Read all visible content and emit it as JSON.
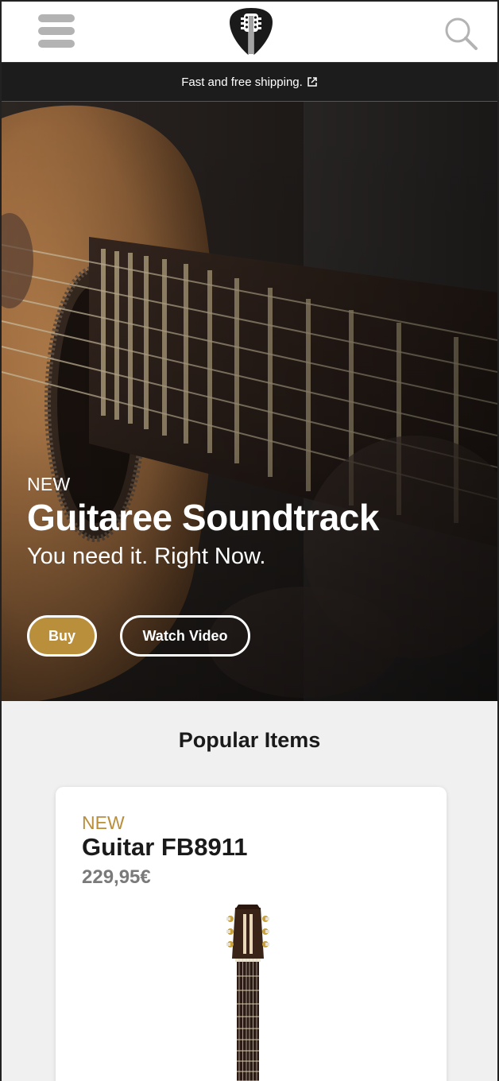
{
  "header": {
    "menu_icon": "hamburger-menu-icon",
    "logo_icon": "guitar-pick-logo-icon",
    "search_icon": "search-icon"
  },
  "shipping_bar": {
    "text": "Fast and free shipping.",
    "icon": "external-link-icon"
  },
  "hero": {
    "tag": "NEW",
    "title": "Guitaree Soundtrack",
    "subtitle": "You need it. Right Now.",
    "buy_label": "Buy",
    "watch_label": "Watch Video"
  },
  "popular": {
    "title": "Popular Items",
    "items": [
      {
        "tag": "NEW",
        "name": "Guitar FB8911",
        "price": "229,95€"
      }
    ]
  },
  "colors": {
    "accent": "#b98f3c",
    "dark_bar": "#1c1c1c",
    "background": "#f0f0f0"
  }
}
